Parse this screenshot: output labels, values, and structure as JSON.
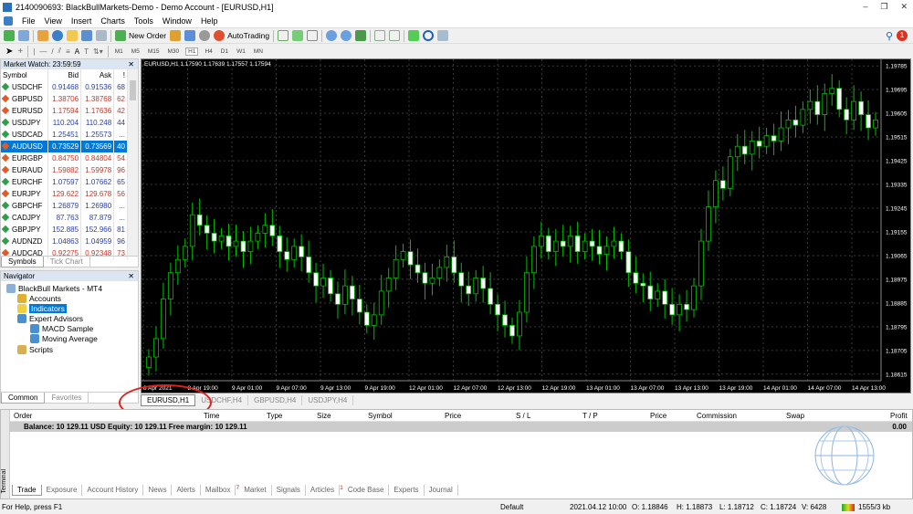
{
  "window": {
    "title": "2140090693: BlackBullMarkets-Demo - Demo Account - [EURUSD,H1]"
  },
  "menu": [
    "File",
    "View",
    "Insert",
    "Charts",
    "Tools",
    "Window",
    "Help"
  ],
  "toolbar": {
    "new_order": "New Order",
    "autotrading": "AutoTrading",
    "notification_count": "1"
  },
  "timeframes": [
    "M1",
    "M5",
    "M15",
    "M30",
    "H1",
    "H4",
    "D1",
    "W1",
    "MN"
  ],
  "active_timeframe": "H1",
  "market_watch": {
    "title": "Market Watch: 23:59:59",
    "columns": [
      "Symbol",
      "Bid",
      "Ask",
      "!"
    ],
    "rows": [
      {
        "symbol": "USDCHF",
        "bid": "0.91468",
        "ask": "0.91536",
        "spread": "68",
        "dir": "up"
      },
      {
        "symbol": "GBPUSD",
        "bid": "1.38706",
        "ask": "1.38768",
        "spread": "62",
        "dir": "down"
      },
      {
        "symbol": "EURUSD",
        "bid": "1.17594",
        "ask": "1.17636",
        "spread": "42",
        "dir": "down"
      },
      {
        "symbol": "USDJPY",
        "bid": "110.204",
        "ask": "110.248",
        "spread": "44",
        "dir": "up"
      },
      {
        "symbol": "USDCAD",
        "bid": "1.25451",
        "ask": "1.25573",
        "spread": "...",
        "dir": "up"
      },
      {
        "symbol": "AUDUSD",
        "bid": "0.73529",
        "ask": "0.73569",
        "spread": "40",
        "dir": "down"
      },
      {
        "symbol": "EURGBP",
        "bid": "0.84750",
        "ask": "0.84804",
        "spread": "54",
        "dir": "down"
      },
      {
        "symbol": "EURAUD",
        "bid": "1.59882",
        "ask": "1.59978",
        "spread": "96",
        "dir": "down"
      },
      {
        "symbol": "EURCHF",
        "bid": "1.07597",
        "ask": "1.07662",
        "spread": "65",
        "dir": "up"
      },
      {
        "symbol": "EURJPY",
        "bid": "129.622",
        "ask": "129.678",
        "spread": "56",
        "dir": "down"
      },
      {
        "symbol": "GBPCHF",
        "bid": "1.26879",
        "ask": "1.26980",
        "spread": "...",
        "dir": "up"
      },
      {
        "symbol": "CADJPY",
        "bid": "87.763",
        "ask": "87.879",
        "spread": "...",
        "dir": "up"
      },
      {
        "symbol": "GBPJPY",
        "bid": "152.885",
        "ask": "152.966",
        "spread": "81",
        "dir": "up"
      },
      {
        "symbol": "AUDNZD",
        "bid": "1.04863",
        "ask": "1.04959",
        "spread": "96",
        "dir": "up"
      },
      {
        "symbol": "AUDCAD",
        "bid": "0.92275",
        "ask": "0.92348",
        "spread": "73",
        "dir": "down"
      }
    ],
    "selected": "AUDUSD",
    "tabs": [
      "Symbols",
      "Tick Chart"
    ]
  },
  "navigator": {
    "title": "Navigator",
    "root": "BlackBull Markets - MT4",
    "items": [
      "Accounts",
      "Indicators",
      "Expert Advisors",
      "MACD Sample",
      "Moving Average",
      "Scripts"
    ],
    "selected": "Indicators",
    "tabs": [
      "Common",
      "Favorites"
    ]
  },
  "chart": {
    "header": "EURUSD,H1  1.17590 1.17639 1.17557 1.17594",
    "chart_tabs": [
      "EURUSD,H1",
      "USDCHF,H4",
      "GBPUSD,H4",
      "USDJPY,H4"
    ],
    "active_tab": "EURUSD,H1"
  },
  "chart_data": {
    "type": "candlestick",
    "symbol": "EURUSD",
    "timeframe": "H1",
    "price_ticks": [
      "1.19785",
      "1.19695",
      "1.19605",
      "1.19515",
      "1.19425",
      "1.19335",
      "1.19245",
      "1.19155",
      "1.19065",
      "1.18975",
      "1.18885",
      "1.18795",
      "1.18705",
      "1.18615"
    ],
    "price_range": [
      1.1859,
      1.1981
    ],
    "time_ticks": [
      "8 Apr 2021",
      "8 Apr 19:00",
      "9 Apr 01:00",
      "9 Apr 07:00",
      "9 Apr 13:00",
      "9 Apr 19:00",
      "12 Apr 01:00",
      "12 Apr 07:00",
      "12 Apr 13:00",
      "12 Apr 19:00",
      "13 Apr 01:00",
      "13 Apr 07:00",
      "13 Apr 13:00",
      "13 Apr 19:00",
      "14 Apr 01:00",
      "14 Apr 07:00",
      "14 Apr 13:00"
    ],
    "closes": [
      1.1868,
      1.1875,
      1.189,
      1.19,
      1.1905,
      1.191,
      1.1922,
      1.1918,
      1.1915,
      1.1912,
      1.1914,
      1.191,
      1.1912,
      1.1908,
      1.1912,
      1.1915,
      1.1918,
      1.1914,
      1.1908,
      1.1905,
      1.191,
      1.1906,
      1.19,
      1.1895,
      1.1898,
      1.1892,
      1.1888,
      1.1895,
      1.189,
      1.1885,
      1.188,
      1.1884,
      1.1893,
      1.1898,
      1.1905,
      1.1908,
      1.1903,
      1.19,
      1.1896,
      1.1898,
      1.1902,
      1.1906,
      1.19,
      1.1895,
      1.1892,
      1.1898,
      1.1894,
      1.1888,
      1.1884,
      1.188,
      1.1876,
      1.1885,
      1.19,
      1.191,
      1.1914,
      1.1908,
      1.1912,
      1.191,
      1.1914,
      1.1908,
      1.1912,
      1.191,
      1.1907,
      1.191,
      1.1912,
      1.1908,
      1.19,
      1.1896,
      1.1895,
      1.189,
      1.1893,
      1.1888,
      1.1884,
      1.1888,
      1.1886,
      1.1895,
      1.1912,
      1.1925,
      1.1935,
      1.1932,
      1.1944,
      1.1948,
      1.1945,
      1.195,
      1.1948,
      1.1952,
      1.195,
      1.1955,
      1.1958,
      1.1956,
      1.1962,
      1.1965,
      1.196,
      1.1968,
      1.197,
      1.1962,
      1.1958,
      1.1965,
      1.196,
      1.1955,
      1.1958
    ],
    "colors": {
      "up_outline": "#00c000",
      "background": "#000000",
      "grid": "#3a3a3a"
    }
  },
  "terminal": {
    "label": "Terminal",
    "columns": [
      "Order",
      "Time",
      "Type",
      "Size",
      "Symbol",
      "Price",
      "S / L",
      "T / P",
      "Price",
      "Commission",
      "Swap",
      "Profit"
    ],
    "balance_line": "Balance: 10 129.11 USD  Equity: 10 129.11  Free margin: 10 129.11",
    "profit": "0.00",
    "tabs": [
      "Trade",
      "Exposure",
      "Account History",
      "News",
      "Alerts",
      "Mailbox",
      "Market",
      "Signals",
      "Articles",
      "Code Base",
      "Experts",
      "Journal"
    ],
    "active_tab": "Trade",
    "mailbox_badge": "7",
    "articles_badge": "1"
  },
  "status": {
    "help": "For Help, press F1",
    "profile": "Default",
    "datetime": "2021.04.12 10:00",
    "open": "O: 1.18846",
    "high": "H: 1.18873",
    "low": "L: 1.18712",
    "close": "C: 1.18724",
    "volume": "V: 6428",
    "traffic": "1555/3 kb"
  }
}
